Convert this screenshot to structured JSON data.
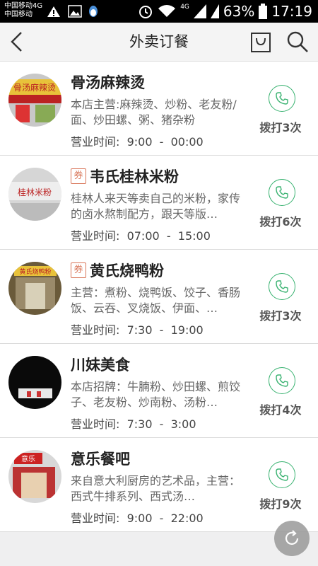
{
  "status_bar": {
    "carrier_line1": "中国移动4G",
    "carrier_line2": "中国移动",
    "network": "4G",
    "battery": "63%",
    "time": "17:19"
  },
  "header": {
    "title": "外卖订餐"
  },
  "restaurants": [
    {
      "name": "骨汤麻辣烫",
      "coupon": "",
      "desc": "本店主营:麻辣烫、炒粉、老友粉/面、炒田螺、粥、猪杂粉",
      "hours": "营业时间:  9:00  -  00:00",
      "call_count": "拨打3次",
      "sign_text": "骨汤麻辣烫"
    },
    {
      "name": "韦氏桂林米粉",
      "coupon": "券",
      "desc": "桂林人来天等卖自己的米粉，家传的卤水熬制配方，跟天等版…",
      "hours": "营业时间:  07:00  -  15:00",
      "call_count": "拨打6次",
      "sign_text": "桂林米粉"
    },
    {
      "name": "黄氏烧鸭粉",
      "coupon": "券",
      "desc": "主营：煮粉、烧鸭饭、饺子、香肠饭、云吞、叉烧饭、伊面、…",
      "hours": "营业时间:  7:30  -  19:00",
      "call_count": "拨打3次",
      "sign_text": "黄氏烧鸭粉"
    },
    {
      "name": "川妹美食",
      "coupon": "",
      "desc": "本店招牌：牛腩粉、炒田螺、煎饺子、老友粉、炒南粉、汤粉…",
      "hours": "营业时间:  7:30  -  3:00",
      "call_count": "拨打4次",
      "sign_text": ""
    },
    {
      "name": "意乐餐吧",
      "coupon": "",
      "desc": "来自意大利厨房的艺术品，主营：西式牛排系列、西式汤…",
      "hours": "营业时间:  9:00  -  22:00",
      "call_count": "拨打9次",
      "sign_text": "意乐"
    }
  ],
  "colors": {
    "accent_green": "#3bb372",
    "coupon_red": "#d9765a"
  },
  "icons": [
    "back-arrow-icon",
    "shopping-bag-icon",
    "search-icon",
    "phone-icon",
    "refresh-icon",
    "coupon-badge"
  ]
}
